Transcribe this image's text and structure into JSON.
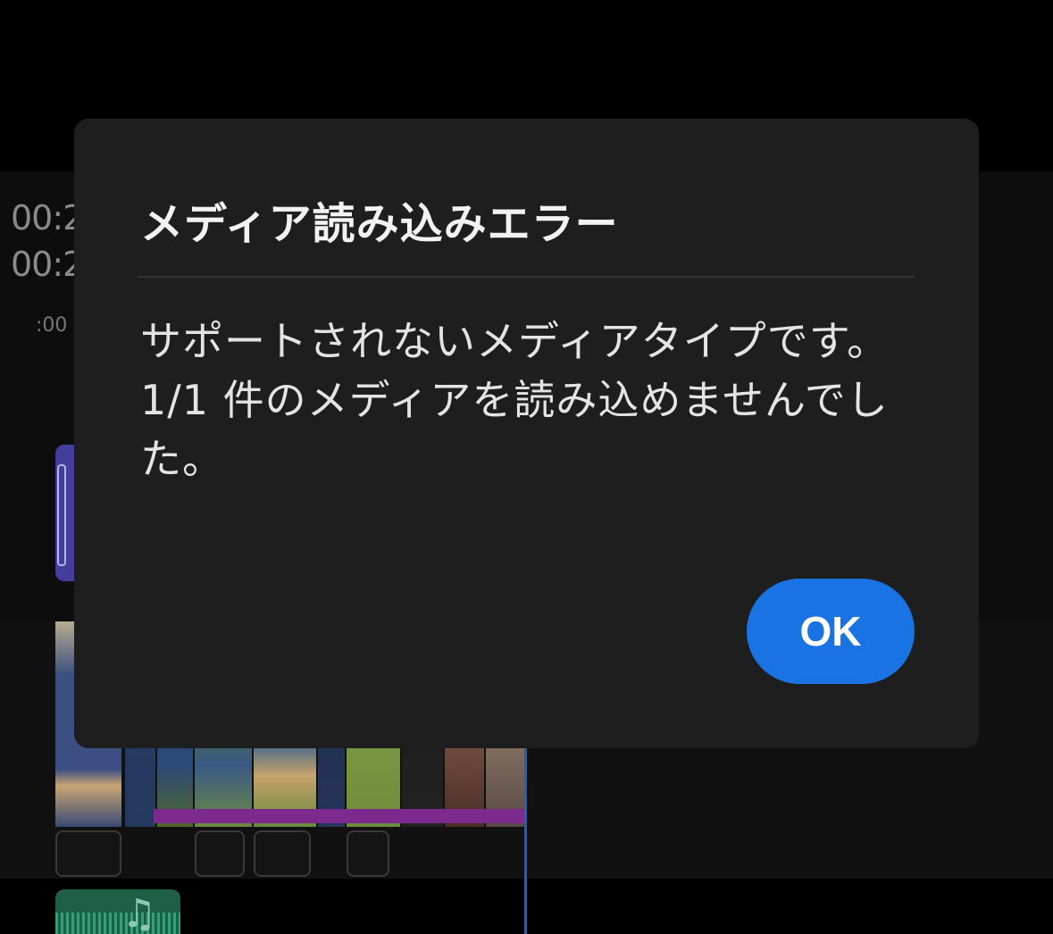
{
  "editor": {
    "time_current": "00:2",
    "time_total": "00:2",
    "ruler_label": ":00"
  },
  "dialog": {
    "title": "メディア読み込みエラー",
    "message": "サポートされないメディアタイプです。1/1 件のメディアを読み込めませんでした。",
    "ok_label": "OK"
  },
  "colors": {
    "dialog_background": "#1e1e1e",
    "primary_button": "#1a73e3",
    "playhead": "#1d5fc2",
    "title_clip": "#433d9c",
    "music_clip": "#1f5f47"
  },
  "icons": [
    "music-note-icon"
  ]
}
